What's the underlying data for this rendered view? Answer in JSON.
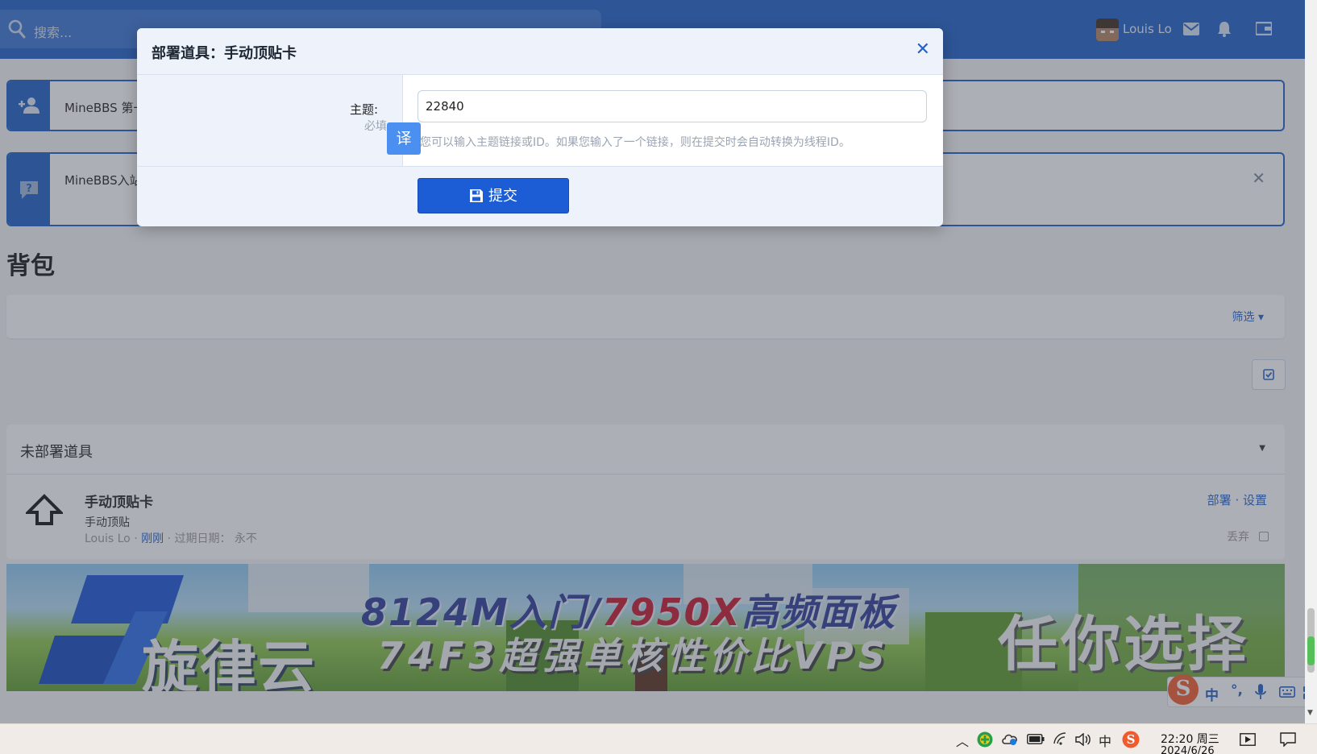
{
  "header": {
    "search_placeholder": "搜索...",
    "username": "Louis Lo"
  },
  "notices": [
    {
      "text": "MineBBS 第一"
    },
    {
      "text": "MineBBS入站"
    }
  ],
  "page": {
    "title": "背包",
    "filter_label": "筛选 ▾"
  },
  "inventory": {
    "section_title": "未部署道具",
    "items": [
      {
        "name": "手动顶贴卡",
        "description": "手动顶贴",
        "owner": "Louis Lo",
        "time": "刚刚",
        "expiry_label": "过期日期：",
        "expiry_value": "永不",
        "action_deploy": "部署",
        "action_settings": "设置",
        "discard_label": "丢弃"
      }
    ]
  },
  "banner": {
    "brand_name": "旋律云",
    "line1_part1": "8124M入门/",
    "line1_part2": "7950X",
    "line1_part3": "高频面板",
    "line2": "74F3超强单核性价比VPS",
    "slogan": "任你选择"
  },
  "modal": {
    "title": "部署道具：手动顶贴卡",
    "field_label": "主题:",
    "field_required": "必填",
    "field_value": "22840",
    "field_hint": "您可以输入主题链接或ID。如果您输入了一个链接，则在提交时会自动转换为线程ID。",
    "translate_label": "译",
    "submit_label": "提交"
  },
  "ime": {
    "logo": "S",
    "mode": "中",
    "punct": "°,"
  },
  "taskbar": {
    "lang": "中",
    "time": "22:20 周三",
    "date": "2024/6/26"
  },
  "colors": {
    "header_bg": "#1f5fc8",
    "accent": "#2462c9",
    "submit_bg": "#1c5cd4",
    "translate_bg": "#4b8ff0"
  }
}
